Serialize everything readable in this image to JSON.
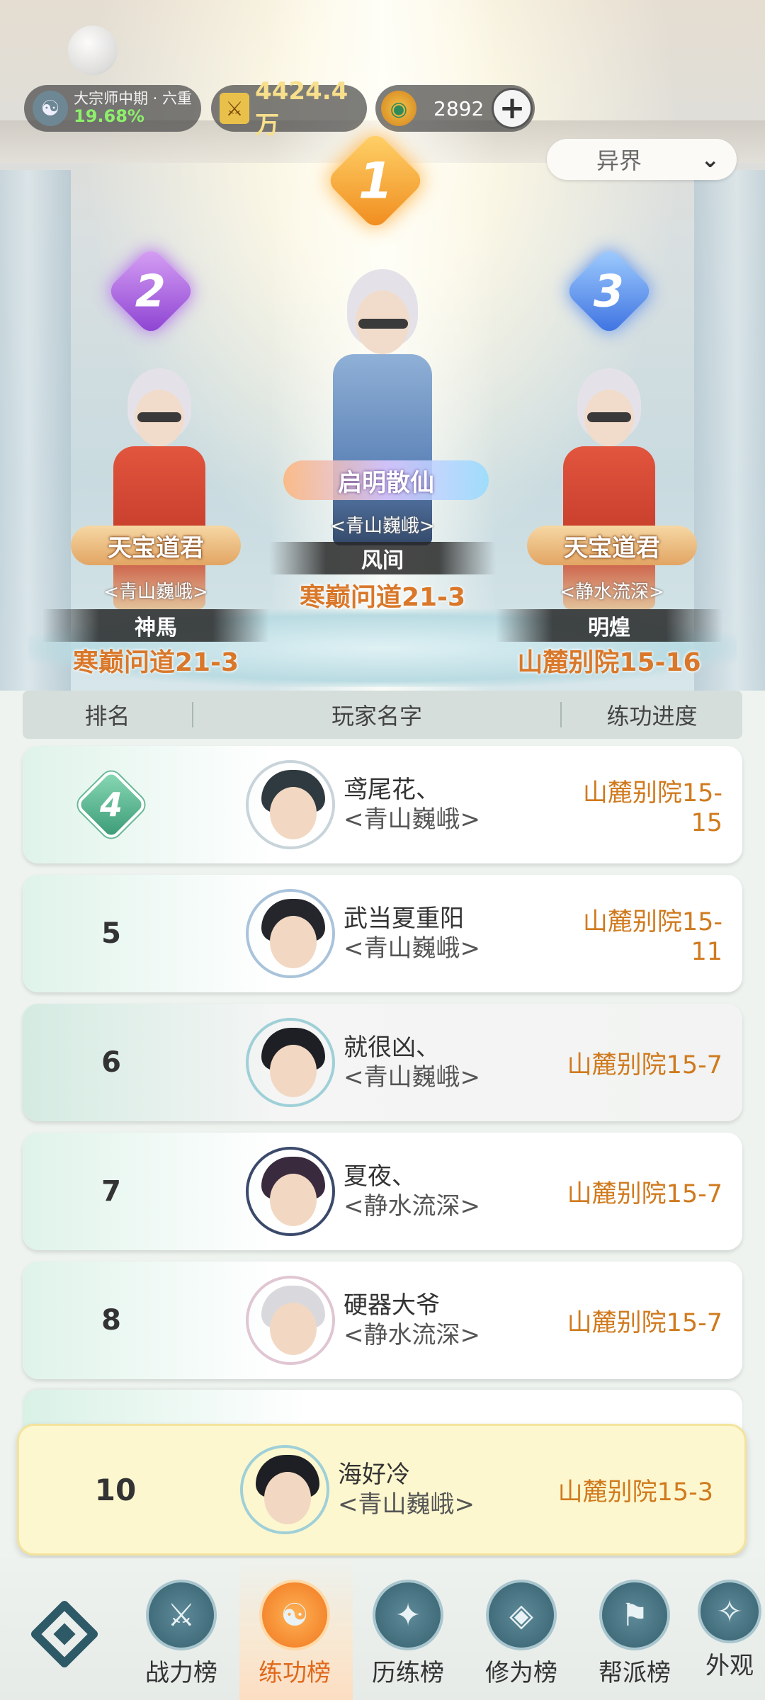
{
  "status": {
    "realm_name": "大宗师中期 · 六重",
    "realm_percent": "19.68%",
    "power_icon": "swords-icon",
    "power_value": "4424.4万",
    "coin_value": "2892",
    "plus_label": "+"
  },
  "server_select": {
    "selected": "异界"
  },
  "podium": [
    {
      "rank": "1",
      "title": "启明散仙",
      "guild": "<青山巍峨>",
      "name": "风间",
      "progress": "寒巅问道21-3"
    },
    {
      "rank": "2",
      "title": "天宝道君",
      "guild": "<青山巍峨>",
      "name": "神馬",
      "progress": "寒巅问道21-3"
    },
    {
      "rank": "3",
      "title": "天宝道君",
      "guild": "<静水流深>",
      "name": "明煌",
      "progress": "山麓别院15-16"
    }
  ],
  "table": {
    "col_rank": "排名",
    "col_name": "玩家名字",
    "col_progress": "练功进度"
  },
  "rows": [
    {
      "rank": "4",
      "name": "鸢尾花、",
      "guild": "<青山巍峨>",
      "progress": "山麓别院15-15"
    },
    {
      "rank": "5",
      "name": "武当夏重阳",
      "guild": "<青山巍峨>",
      "progress": "山麓别院15-11"
    },
    {
      "rank": "6",
      "name": "就很凶、",
      "guild": "<青山巍峨>",
      "progress": "山麓别院15-7"
    },
    {
      "rank": "7",
      "name": "夏夜、",
      "guild": "<静水流深>",
      "progress": "山麓别院15-7"
    },
    {
      "rank": "8",
      "name": "硬器大爷",
      "guild": "<静水流深>",
      "progress": "山麓别院15-7"
    }
  ],
  "self_row": {
    "rank": "10",
    "name": "海好冷",
    "guild": "<青山巍峨>",
    "progress": "山麓别院15-3"
  },
  "nav": [
    {
      "label": "战力榜",
      "icon": "crossed-swords-icon"
    },
    {
      "label": "练功榜",
      "icon": "yin-yang-icon",
      "active": true
    },
    {
      "label": "历练榜",
      "icon": "compass-star-icon"
    },
    {
      "label": "修为榜",
      "icon": "meditation-icon"
    },
    {
      "label": "帮派榜",
      "icon": "banner-icon"
    },
    {
      "label": "外观",
      "icon": "costume-icon"
    }
  ],
  "colors": {
    "accent_orange": "#d07a1e",
    "active_nav": "#e0691c",
    "realm_percent": "#8df06a"
  }
}
